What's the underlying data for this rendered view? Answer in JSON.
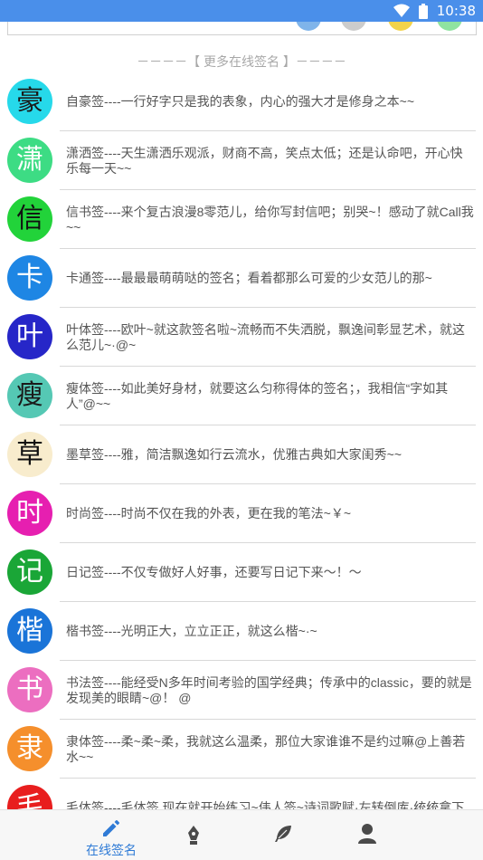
{
  "status_bar": {
    "time": "10:38",
    "icons": [
      "wifi-icon",
      "battery-icon"
    ],
    "color": "#4a8fea"
  },
  "section_header": "－－－－【 更多在线签名 】－－－－",
  "items": [
    {
      "char": "豪",
      "bg": "#26d9ea",
      "fg": "#1a1a1a",
      "text": "自豪签----一行好字只是我的表象，内心的强大才是修身之本~~"
    },
    {
      "char": "潇",
      "bg": "#3ddc84",
      "fg": "#ffffff",
      "text": "潇洒签----天生潇洒乐观派，财商不高，笑点太低；还是认命吧，开心快乐每一天~~"
    },
    {
      "char": "信",
      "bg": "#22d33a",
      "fg": "#111111",
      "text": "信书签----来个复古浪漫8零范儿，给你写封信吧；别哭~！感动了就Call我~~"
    },
    {
      "char": "卡",
      "bg": "#1e86e4",
      "fg": "#ffffff",
      "text": "卡通签----最最最萌萌哒的签名；看着都那么可爱的少女范儿的那~"
    },
    {
      "char": "叶",
      "bg": "#2626c8",
      "fg": "#ffffff",
      "text": "叶体签----欧叶~就这款签名啦~流畅而不失洒脱，飘逸间彰显艺术，就这么范儿~·@~"
    },
    {
      "char": "瘦",
      "bg": "#55c8b4",
      "fg": "#1a1a1a",
      "text": "瘦体签----如此美好身材，就要这么匀称得体的签名；，我相信“字如其人”@~~"
    },
    {
      "char": "草",
      "bg": "#f8eccd",
      "fg": "#111111",
      "text": "墨草签----雅，简洁飘逸如行云流水，优雅古典如大家闺秀~~"
    },
    {
      "char": "时",
      "bg": "#e61fb0",
      "fg": "#ffffff",
      "text": "时尚签----时尚不仅在我的外表，更在我的笔法~￥~"
    },
    {
      "char": "记",
      "bg": "#1aa637",
      "fg": "#ffffff",
      "text": "日记签----不仅专做好人好事，还要写日记下来～！～"
    },
    {
      "char": "楷",
      "bg": "#1a74d8",
      "fg": "#ffffff",
      "text": "楷书签----光明正大，立立正正，就这么楷~·~"
    },
    {
      "char": "书",
      "bg": "#ec6ec0",
      "fg": "#ffffff",
      "text": "书法签----能经受N多年时间考验的国学经典；传承中的classic，要的就是发现美的眼睛~@！ @"
    },
    {
      "char": "隶",
      "bg": "#f58f2c",
      "fg": "#ffffff",
      "text": "隶体签----柔~柔~柔，我就这么温柔，那位大家谁谁不是约过嘛@上善若水~~"
    },
    {
      "char": "毛",
      "bg": "#e81e1e",
      "fg": "#ffffff",
      "text": "毛体签----毛体签  现在就开始练习~伟人签~诗词歌赋·左转倒库·统统拿下"
    }
  ],
  "nav": {
    "tabs": [
      {
        "label": "在线签名",
        "icon": "pencil-icon",
        "active": true
      },
      {
        "label": "",
        "icon": "pen-nib-icon",
        "active": false
      },
      {
        "label": "",
        "icon": "feather-icon",
        "active": false
      },
      {
        "label": "",
        "icon": "person-icon",
        "active": false
      }
    ],
    "active_color": "#2f7bd6",
    "inactive_color": "#4a4a4a"
  }
}
